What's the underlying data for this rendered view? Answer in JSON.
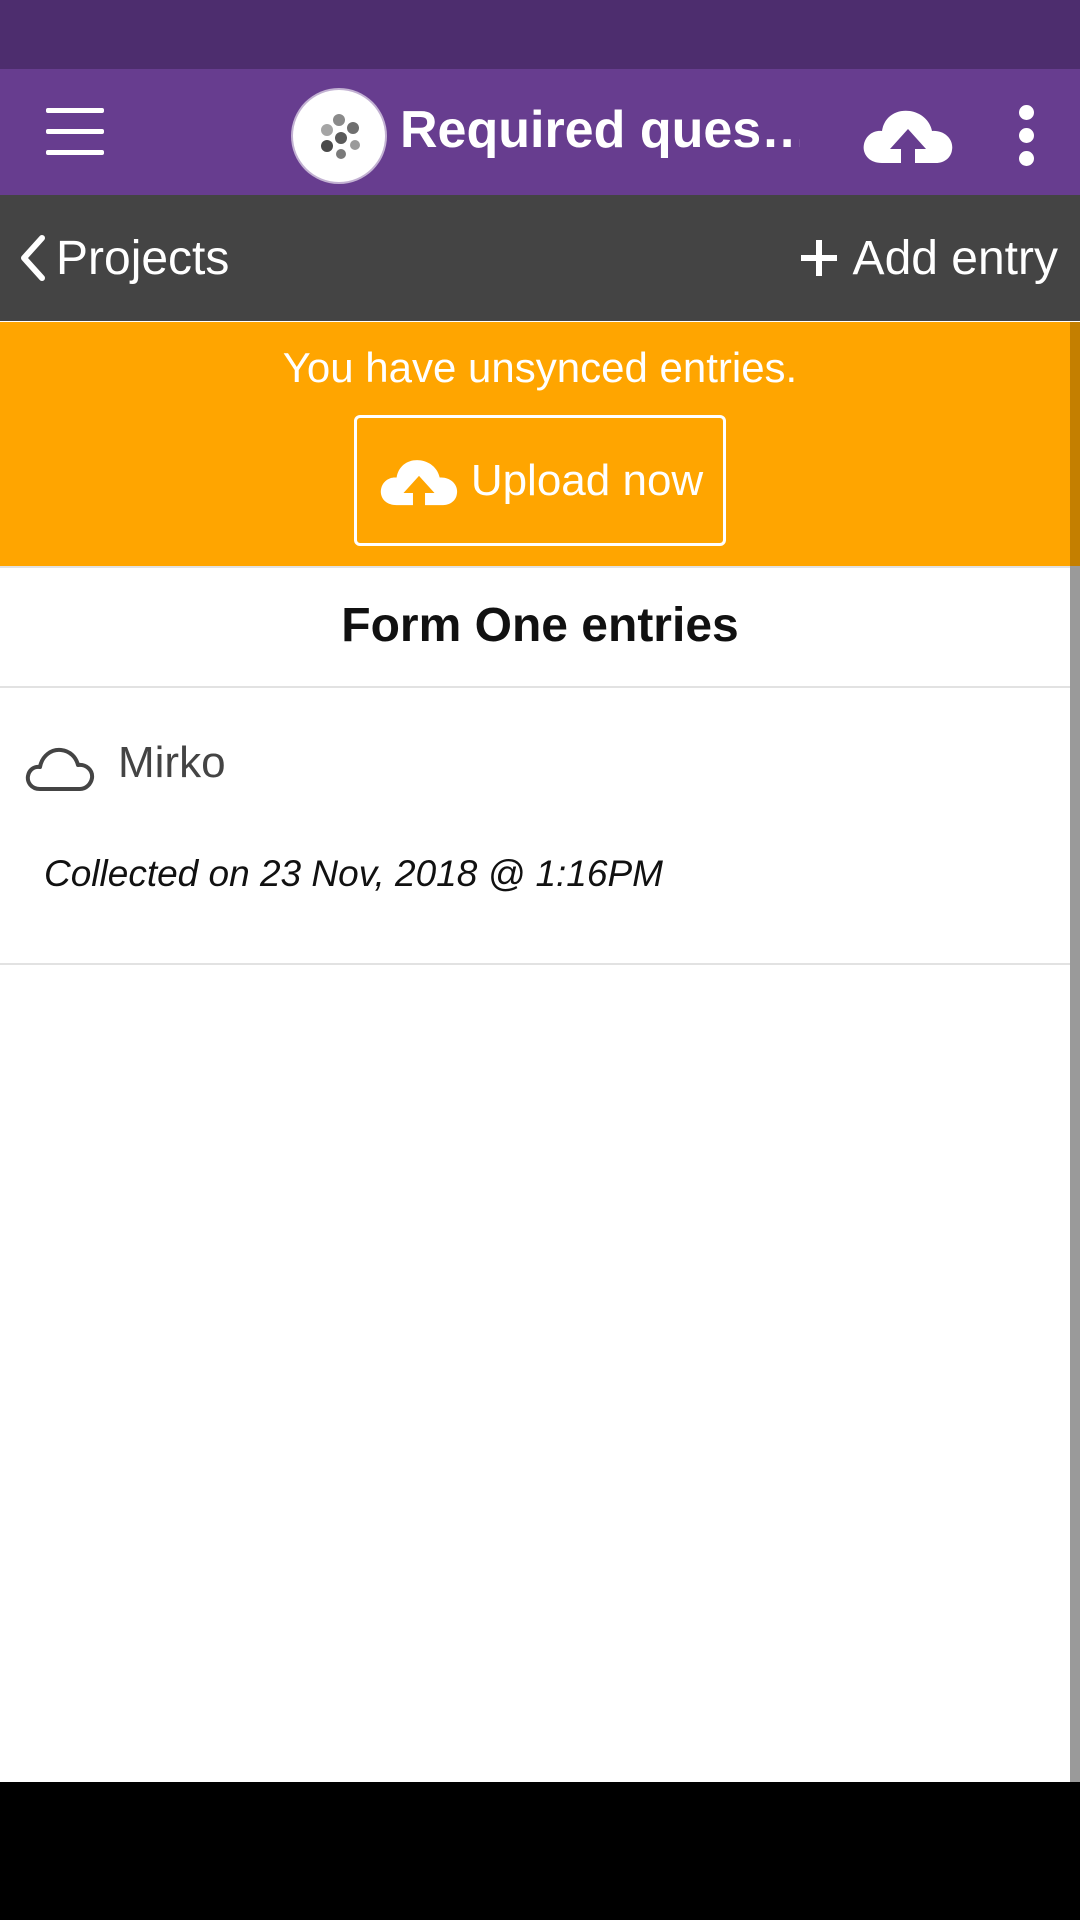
{
  "app_bar": {
    "title": "Required ques…",
    "menu_icon": "hamburger-menu-icon",
    "logo_icon": "project-logo-icon",
    "upload_icon": "cloud-upload-icon",
    "overflow_icon": "more-vertical-icon"
  },
  "nav_bar": {
    "back_label": "Projects",
    "add_label": "Add entry"
  },
  "sync_banner": {
    "message": "You have unsynced entries.",
    "upload_label": "Upload now"
  },
  "form": {
    "title": "Form One entries"
  },
  "entries": [
    {
      "name": "Mirko",
      "collected": "Collected on 23 Nov, 2018 @ 1:16PM",
      "status_icon": "cloud-unsynced-icon"
    }
  ],
  "colors": {
    "status_bar": "#4d2d6e",
    "app_bar": "#673d8f",
    "nav_bar": "#444444",
    "banner": "#ffa500"
  }
}
